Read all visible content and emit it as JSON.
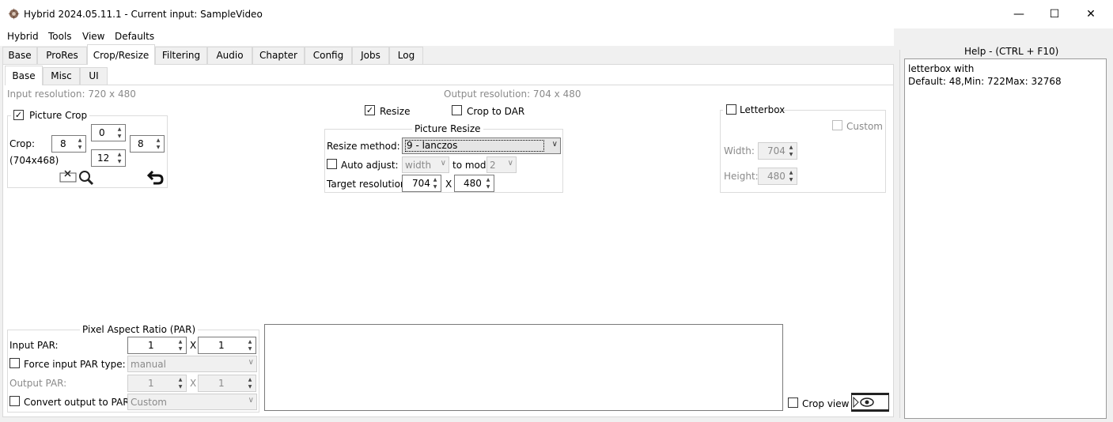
{
  "window": {
    "title": "Hybrid 2024.05.11.1 - Current input: SampleVideo",
    "minimize": "—",
    "maximize": "☐",
    "close": "✕"
  },
  "menu": [
    "Hybrid",
    "Tools",
    "View",
    "Defaults"
  ],
  "tabs": [
    "Base",
    "ProRes",
    "Crop/Resize",
    "Filtering",
    "Audio",
    "Chapter",
    "Config",
    "Jobs",
    "Log"
  ],
  "active_tab": "Crop/Resize",
  "subtabs": [
    "Base",
    "Misc",
    "UI"
  ],
  "input_resolution": "Input resolution: 720 x 480",
  "output_resolution": "Output resolution: 704 x 480",
  "crop": {
    "title": "Picture Crop",
    "checked": true,
    "label": "Crop:",
    "top": "0",
    "left": "8",
    "right": "8",
    "bottom": "12",
    "result": "(704x468)"
  },
  "resize": {
    "resize_label": "Resize",
    "resize_checked": true,
    "crop_to_dar_label": "Crop to DAR",
    "crop_to_dar_checked": false,
    "group_title": "Picture Resize",
    "method_label": "Resize method:",
    "method_value": "9 - lanczos",
    "auto_adjust_label": "Auto adjust:",
    "auto_adjust_value": "width",
    "to_mod_label": "to mod",
    "mod_value": "2",
    "target_label": "Target resolution:",
    "target_width": "704",
    "x_sep": "X",
    "target_height": "480"
  },
  "letterbox": {
    "label": "Letterbox",
    "custom_label": "Custom",
    "width_label": "Width:",
    "width_value": "704",
    "height_label": "Height:",
    "height_value": "480"
  },
  "par": {
    "title": "Pixel Aspect Ratio (PAR)",
    "input_label": "Input PAR:",
    "input_a": "1",
    "x_sep": "X",
    "input_b": "1",
    "force_label": "Force input PAR type:",
    "force_value": "manual",
    "output_label": "Output PAR:",
    "output_a": "1",
    "output_b": "1",
    "convert_label": "Convert output to PAR:",
    "convert_value": "Custom"
  },
  "crop_view_label": "Crop view",
  "help": {
    "title": "Help - (CTRL + F10)",
    "line1": "letterbox with",
    "line2": "Default: 48,Min: 722Max: 32768"
  }
}
